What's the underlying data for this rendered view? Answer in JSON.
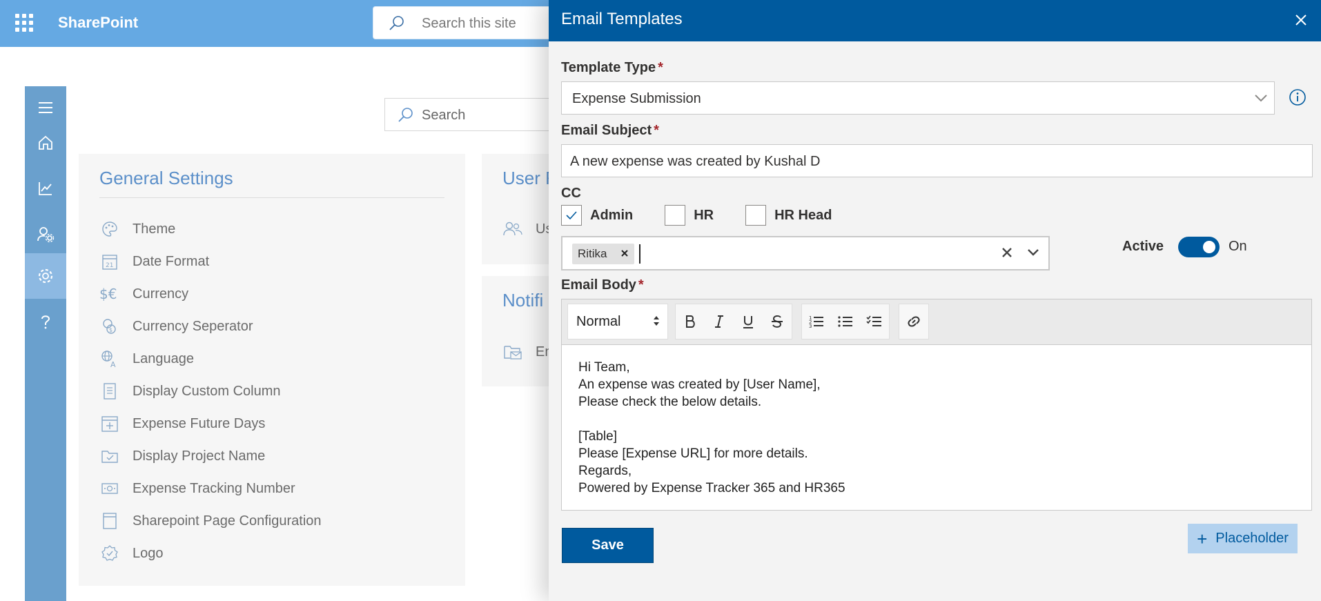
{
  "suitebar": {
    "brand": "SharePoint",
    "search_placeholder": "Search this site"
  },
  "page": {
    "search_placeholder": "Search"
  },
  "general_settings": {
    "title": "General Settings",
    "items": [
      {
        "label": "Theme",
        "icon": "palette-icon"
      },
      {
        "label": "Date Format",
        "icon": "calendar-icon"
      },
      {
        "label": "Currency",
        "icon": "currency-icon"
      },
      {
        "label": "Currency Seperator",
        "icon": "coins-icon"
      },
      {
        "label": "Language",
        "icon": "translate-icon"
      },
      {
        "label": "Display Custom Column",
        "icon": "document-icon"
      },
      {
        "label": "Expense Future Days",
        "icon": "calendar-add-icon"
      },
      {
        "label": "Display Project Name",
        "icon": "folder-icon"
      },
      {
        "label": "Expense Tracking Number",
        "icon": "money-icon"
      },
      {
        "label": "Sharepoint Page Configuration",
        "icon": "page-icon"
      },
      {
        "label": "Logo",
        "icon": "badge-icon"
      }
    ]
  },
  "user_card": {
    "title": "User F",
    "item": "Us"
  },
  "notif_card": {
    "title": "Notifi",
    "item": "En"
  },
  "panel": {
    "title": "Email Templates",
    "template_type": {
      "label": "Template Type",
      "required": "*",
      "value": "Expense Submission"
    },
    "email_subject": {
      "label": "Email Subject",
      "required": "*",
      "value": "A new expense was created by Kushal D"
    },
    "cc": {
      "label": "CC",
      "options": [
        {
          "label": "Admin",
          "checked": true
        },
        {
          "label": "HR",
          "checked": false
        },
        {
          "label": "HR Head",
          "checked": false
        }
      ],
      "selected_people": [
        "Ritika"
      ]
    },
    "active": {
      "label": "Active",
      "state": "On",
      "on": true
    },
    "email_body": {
      "label": "Email Body",
      "required": "*",
      "format": "Normal",
      "lines": [
        "Hi Team,",
        "An expense was created by [User Name],",
        "Please check the below details.",
        "",
        "[Table]",
        "Please [Expense URL] for more details.",
        "Regards,",
        "Powered by Expense Tracker 365 and HR365"
      ]
    },
    "save_label": "Save",
    "placeholder_label": "Placeholder"
  },
  "colors": {
    "suitebar": "#65a9e3",
    "header": "#005a9e",
    "accent": "#5b8fc9",
    "rail": "#6aa0cd"
  }
}
